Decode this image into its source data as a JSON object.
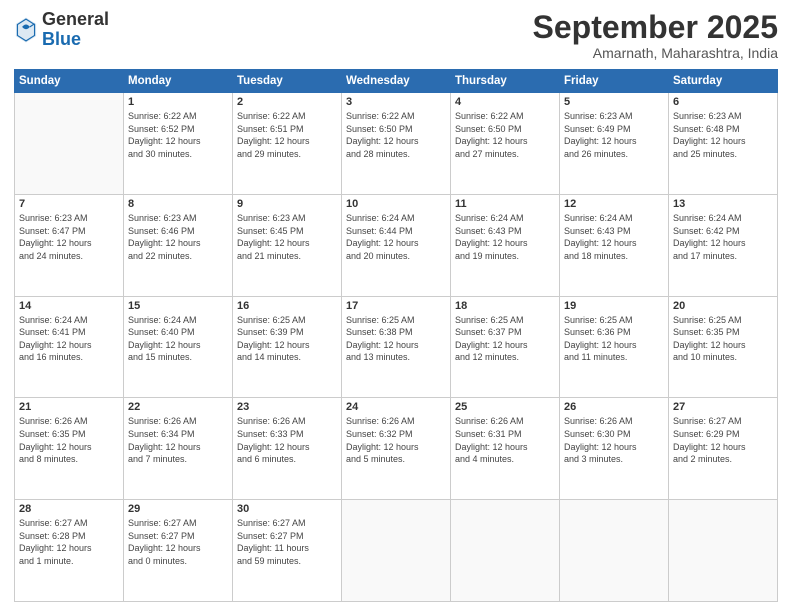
{
  "header": {
    "logo_general": "General",
    "logo_blue": "Blue",
    "month_title": "September 2025",
    "subtitle": "Amarnath, Maharashtra, India"
  },
  "days_of_week": [
    "Sunday",
    "Monday",
    "Tuesday",
    "Wednesday",
    "Thursday",
    "Friday",
    "Saturday"
  ],
  "weeks": [
    [
      {
        "day": "",
        "info": ""
      },
      {
        "day": "1",
        "info": "Sunrise: 6:22 AM\nSunset: 6:52 PM\nDaylight: 12 hours\nand 30 minutes."
      },
      {
        "day": "2",
        "info": "Sunrise: 6:22 AM\nSunset: 6:51 PM\nDaylight: 12 hours\nand 29 minutes."
      },
      {
        "day": "3",
        "info": "Sunrise: 6:22 AM\nSunset: 6:50 PM\nDaylight: 12 hours\nand 28 minutes."
      },
      {
        "day": "4",
        "info": "Sunrise: 6:22 AM\nSunset: 6:50 PM\nDaylight: 12 hours\nand 27 minutes."
      },
      {
        "day": "5",
        "info": "Sunrise: 6:23 AM\nSunset: 6:49 PM\nDaylight: 12 hours\nand 26 minutes."
      },
      {
        "day": "6",
        "info": "Sunrise: 6:23 AM\nSunset: 6:48 PM\nDaylight: 12 hours\nand 25 minutes."
      }
    ],
    [
      {
        "day": "7",
        "info": "Sunrise: 6:23 AM\nSunset: 6:47 PM\nDaylight: 12 hours\nand 24 minutes."
      },
      {
        "day": "8",
        "info": "Sunrise: 6:23 AM\nSunset: 6:46 PM\nDaylight: 12 hours\nand 22 minutes."
      },
      {
        "day": "9",
        "info": "Sunrise: 6:23 AM\nSunset: 6:45 PM\nDaylight: 12 hours\nand 21 minutes."
      },
      {
        "day": "10",
        "info": "Sunrise: 6:24 AM\nSunset: 6:44 PM\nDaylight: 12 hours\nand 20 minutes."
      },
      {
        "day": "11",
        "info": "Sunrise: 6:24 AM\nSunset: 6:43 PM\nDaylight: 12 hours\nand 19 minutes."
      },
      {
        "day": "12",
        "info": "Sunrise: 6:24 AM\nSunset: 6:43 PM\nDaylight: 12 hours\nand 18 minutes."
      },
      {
        "day": "13",
        "info": "Sunrise: 6:24 AM\nSunset: 6:42 PM\nDaylight: 12 hours\nand 17 minutes."
      }
    ],
    [
      {
        "day": "14",
        "info": "Sunrise: 6:24 AM\nSunset: 6:41 PM\nDaylight: 12 hours\nand 16 minutes."
      },
      {
        "day": "15",
        "info": "Sunrise: 6:24 AM\nSunset: 6:40 PM\nDaylight: 12 hours\nand 15 minutes."
      },
      {
        "day": "16",
        "info": "Sunrise: 6:25 AM\nSunset: 6:39 PM\nDaylight: 12 hours\nand 14 minutes."
      },
      {
        "day": "17",
        "info": "Sunrise: 6:25 AM\nSunset: 6:38 PM\nDaylight: 12 hours\nand 13 minutes."
      },
      {
        "day": "18",
        "info": "Sunrise: 6:25 AM\nSunset: 6:37 PM\nDaylight: 12 hours\nand 12 minutes."
      },
      {
        "day": "19",
        "info": "Sunrise: 6:25 AM\nSunset: 6:36 PM\nDaylight: 12 hours\nand 11 minutes."
      },
      {
        "day": "20",
        "info": "Sunrise: 6:25 AM\nSunset: 6:35 PM\nDaylight: 12 hours\nand 10 minutes."
      }
    ],
    [
      {
        "day": "21",
        "info": "Sunrise: 6:26 AM\nSunset: 6:35 PM\nDaylight: 12 hours\nand 8 minutes."
      },
      {
        "day": "22",
        "info": "Sunrise: 6:26 AM\nSunset: 6:34 PM\nDaylight: 12 hours\nand 7 minutes."
      },
      {
        "day": "23",
        "info": "Sunrise: 6:26 AM\nSunset: 6:33 PM\nDaylight: 12 hours\nand 6 minutes."
      },
      {
        "day": "24",
        "info": "Sunrise: 6:26 AM\nSunset: 6:32 PM\nDaylight: 12 hours\nand 5 minutes."
      },
      {
        "day": "25",
        "info": "Sunrise: 6:26 AM\nSunset: 6:31 PM\nDaylight: 12 hours\nand 4 minutes."
      },
      {
        "day": "26",
        "info": "Sunrise: 6:26 AM\nSunset: 6:30 PM\nDaylight: 12 hours\nand 3 minutes."
      },
      {
        "day": "27",
        "info": "Sunrise: 6:27 AM\nSunset: 6:29 PM\nDaylight: 12 hours\nand 2 minutes."
      }
    ],
    [
      {
        "day": "28",
        "info": "Sunrise: 6:27 AM\nSunset: 6:28 PM\nDaylight: 12 hours\nand 1 minute."
      },
      {
        "day": "29",
        "info": "Sunrise: 6:27 AM\nSunset: 6:27 PM\nDaylight: 12 hours\nand 0 minutes."
      },
      {
        "day": "30",
        "info": "Sunrise: 6:27 AM\nSunset: 6:27 PM\nDaylight: 11 hours\nand 59 minutes."
      },
      {
        "day": "",
        "info": ""
      },
      {
        "day": "",
        "info": ""
      },
      {
        "day": "",
        "info": ""
      },
      {
        "day": "",
        "info": ""
      }
    ]
  ]
}
